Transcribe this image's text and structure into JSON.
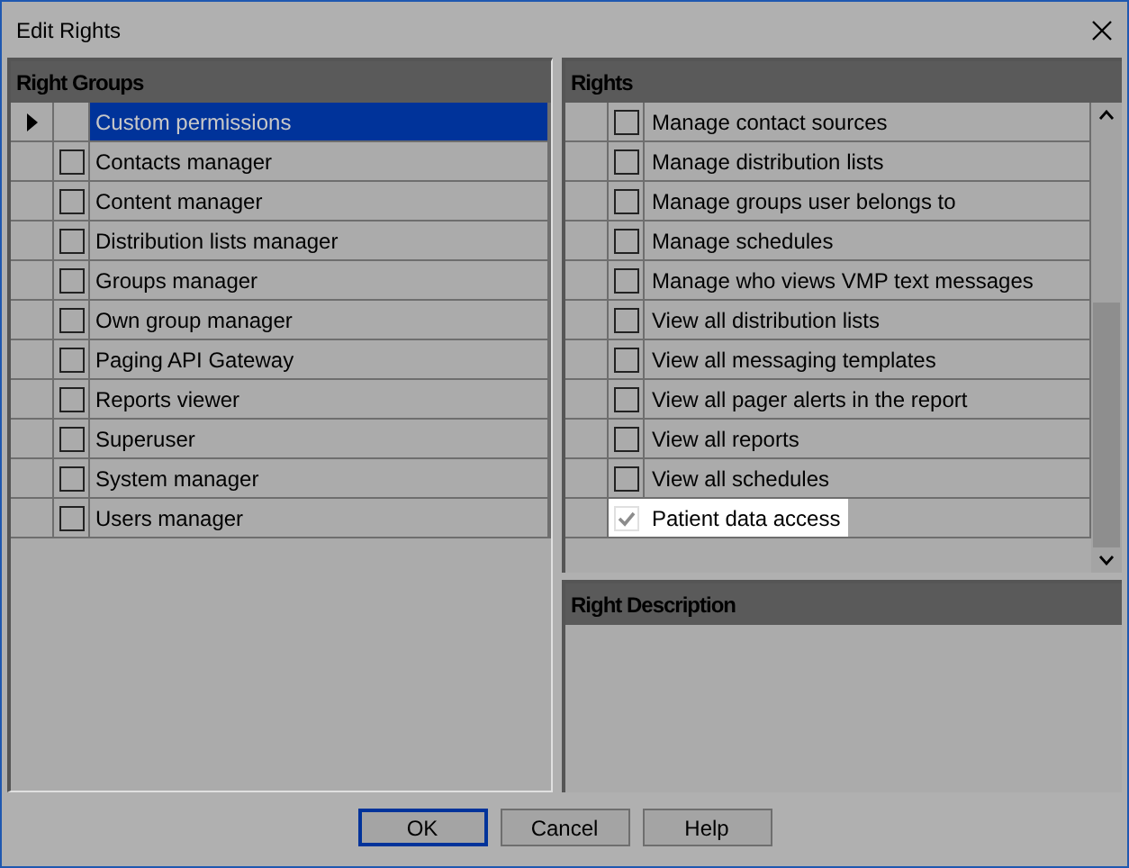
{
  "window": {
    "title": "Edit Rights"
  },
  "right_groups": {
    "heading": "Right Groups",
    "rows": [
      {
        "kind": "custom",
        "label": "Custom permissions",
        "selected": true
      },
      {
        "kind": "group",
        "label": "Contacts manager",
        "selected": false,
        "checked": false
      },
      {
        "kind": "group",
        "label": "Content manager",
        "selected": false,
        "checked": false
      },
      {
        "kind": "group",
        "label": "Distribution lists manager",
        "selected": false,
        "checked": false
      },
      {
        "kind": "group",
        "label": "Groups manager",
        "selected": false,
        "checked": false
      },
      {
        "kind": "group",
        "label": "Own group manager",
        "selected": false,
        "checked": false
      },
      {
        "kind": "group",
        "label": "Paging API Gateway",
        "selected": false,
        "checked": false
      },
      {
        "kind": "group",
        "label": "Reports viewer",
        "selected": false,
        "checked": false
      },
      {
        "kind": "group",
        "label": "Superuser",
        "selected": false,
        "checked": false
      },
      {
        "kind": "group",
        "label": "System manager",
        "selected": false,
        "checked": false
      },
      {
        "kind": "group",
        "label": "Users manager",
        "selected": false,
        "checked": false
      }
    ]
  },
  "rights": {
    "heading": "Rights",
    "rows": [
      {
        "label": "Manage contact sources",
        "checked": false,
        "disabled": false,
        "selected": false
      },
      {
        "label": "Manage distribution lists",
        "checked": false,
        "disabled": false,
        "selected": false
      },
      {
        "label": "Manage groups user belongs to",
        "checked": false,
        "disabled": false,
        "selected": false
      },
      {
        "label": "Manage schedules",
        "checked": false,
        "disabled": false,
        "selected": false
      },
      {
        "label": "Manage who views VMP text messages",
        "checked": false,
        "disabled": false,
        "selected": false
      },
      {
        "label": "View all distribution lists",
        "checked": false,
        "disabled": false,
        "selected": false
      },
      {
        "label": "View all messaging templates",
        "checked": false,
        "disabled": false,
        "selected": false
      },
      {
        "label": "View all pager alerts in the report",
        "checked": false,
        "disabled": false,
        "selected": false
      },
      {
        "label": "View all reports",
        "checked": false,
        "disabled": false,
        "selected": false
      },
      {
        "label": "View all schedules",
        "checked": false,
        "disabled": false,
        "selected": false
      },
      {
        "label": "Patient data access",
        "checked": true,
        "disabled": true,
        "selected": true
      }
    ]
  },
  "right_description": {
    "heading": "Right Description"
  },
  "buttons": [
    {
      "label": "OK",
      "default": true
    },
    {
      "label": "Cancel",
      "default": false
    },
    {
      "label": "Help",
      "default": false
    }
  ]
}
